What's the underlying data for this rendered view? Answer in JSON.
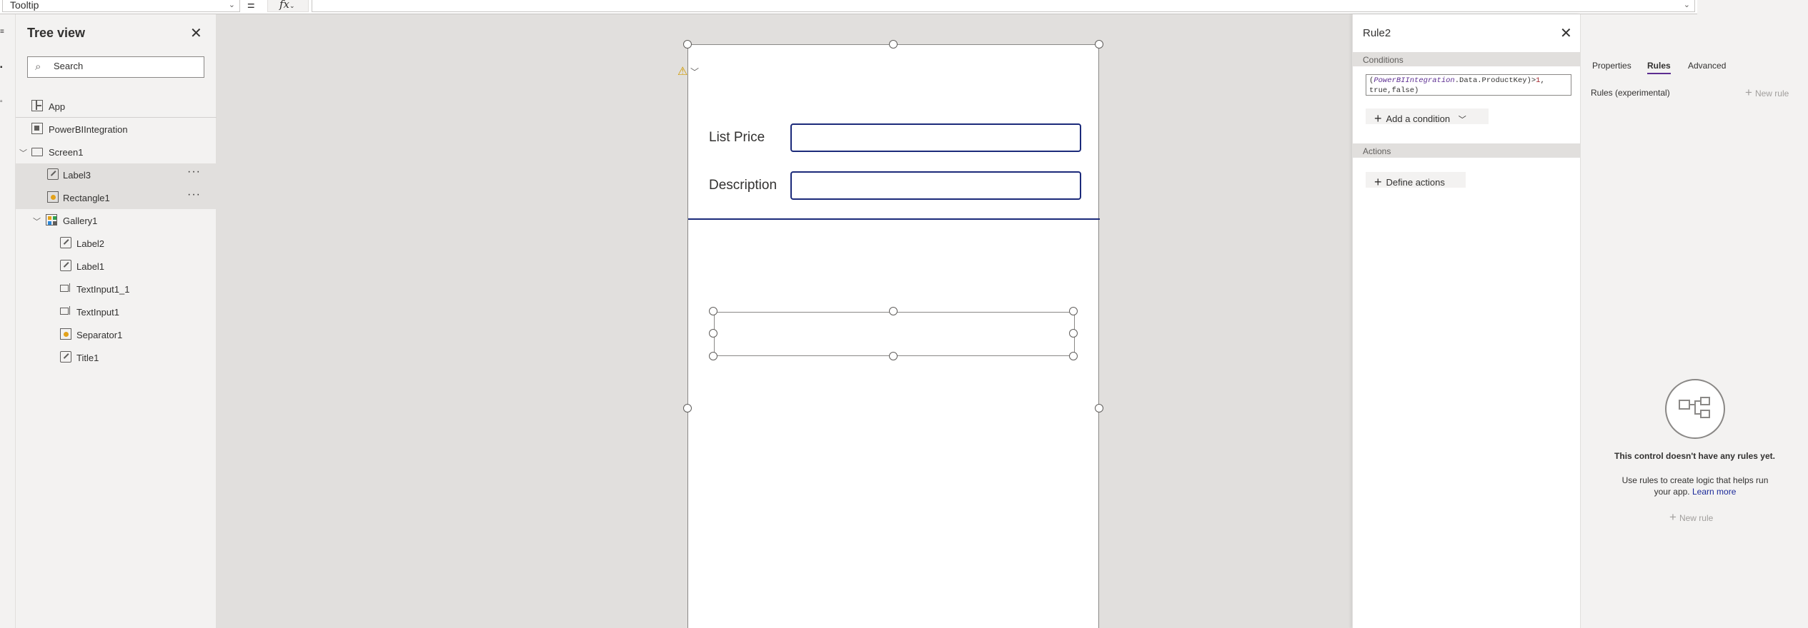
{
  "formula_bar": {
    "property_value": "Tooltip",
    "equals": "=",
    "fx_label": "fx",
    "formula": ""
  },
  "tree": {
    "title": "Tree view",
    "search_placeholder": "Search",
    "items": [
      {
        "label": "App",
        "icon": "app-icon"
      },
      {
        "label": "PowerBIIntegration",
        "icon": "powerbi-icon"
      },
      {
        "label": "Screen1",
        "icon": "screen-icon",
        "expanded": true
      },
      {
        "label": "Label3",
        "icon": "label-icon",
        "selected": true
      },
      {
        "label": "Rectangle1",
        "icon": "rectangle-icon",
        "selected": true
      },
      {
        "label": "Gallery1",
        "icon": "gallery-icon",
        "expanded": true
      },
      {
        "label": "Label2",
        "icon": "label-icon"
      },
      {
        "label": "Label1",
        "icon": "label-icon"
      },
      {
        "label": "TextInput1_1",
        "icon": "textinput-icon"
      },
      {
        "label": "TextInput1",
        "icon": "textinput-icon"
      },
      {
        "label": "Separator1",
        "icon": "separator-icon"
      },
      {
        "label": "Title1",
        "icon": "label-icon"
      }
    ],
    "more": "···"
  },
  "canvas": {
    "fields": [
      {
        "label": "List Price",
        "value": ""
      },
      {
        "label": "Description",
        "value": ""
      }
    ]
  },
  "rule_panel": {
    "title": "Rule2",
    "conditions_header": "Conditions",
    "condition_code_fn": "PowerBIIntegration",
    "condition_code_rest": ".Data.ProductKey)>",
    "condition_code_num": "1",
    "condition_code_tail": ",",
    "condition_code_line2": "true,false)",
    "add_condition": "Add a condition",
    "actions_header": "Actions",
    "define_actions": "Define actions"
  },
  "properties_panel": {
    "tabs": [
      "Properties",
      "Rules",
      "Advanced"
    ],
    "active_tab": "Rules",
    "rules_experimental": "Rules (experimental)",
    "new_rule": "New rule",
    "empty_title": "This control doesn't have any rules yet.",
    "empty_desc": "Use rules to create logic that helps run your app.",
    "learn_more": "Learn more"
  },
  "colors": {
    "accent": "#5c2d91",
    "input_border": "#1b2a7a",
    "warning": "#d19b00"
  }
}
